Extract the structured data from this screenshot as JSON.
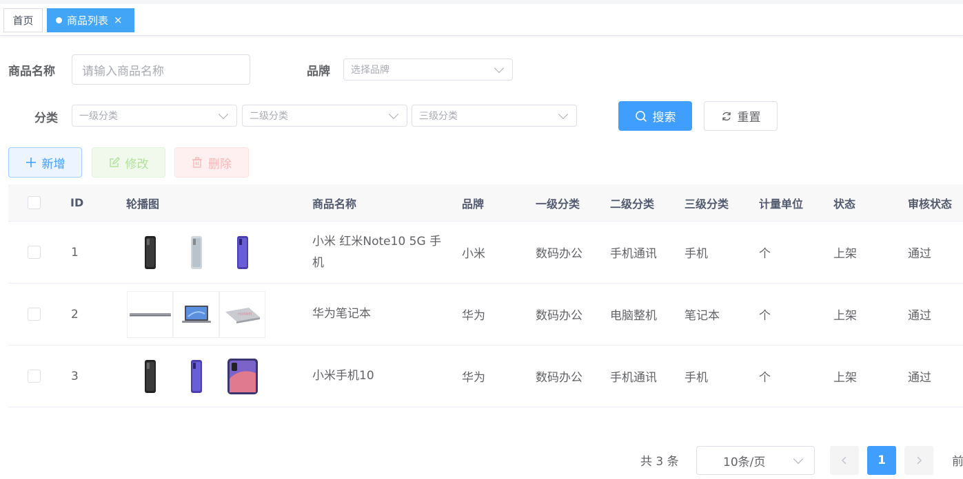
{
  "tabs": [
    {
      "label": "首页",
      "active": false
    },
    {
      "label": "商品列表",
      "active": true
    }
  ],
  "form": {
    "name_label": "商品名称",
    "name_placeholder": "请输入商品名称",
    "brand_label": "品牌",
    "brand_placeholder": "选择品牌",
    "category_label": "分类",
    "cat1_placeholder": "一级分类",
    "cat2_placeholder": "二级分类",
    "cat3_placeholder": "三级分类",
    "search_label": "搜索",
    "reset_label": "重置"
  },
  "toolbar": {
    "add_label": "新增",
    "edit_label": "修改",
    "delete_label": "删除"
  },
  "table": {
    "headers": [
      "ID",
      "轮播图",
      "商品名称",
      "品牌",
      "一级分类",
      "二级分类",
      "三级分类",
      "计量单位",
      "状态",
      "审核状态"
    ],
    "rows": [
      {
        "id": "1",
        "name": "小米 红米Note10 5G 手机",
        "brand": "小米",
        "cat1": "数码办公",
        "cat2": "手机通讯",
        "cat3": "手机",
        "unit": "个",
        "status": "上架",
        "audit": "通过",
        "images": [
          "phone-black",
          "phone-silver",
          "phone-purple"
        ]
      },
      {
        "id": "2",
        "name": "华为笔记本",
        "brand": "华为",
        "cat1": "数码办公",
        "cat2": "电脑整机",
        "cat3": "笔记本",
        "unit": "个",
        "status": "上架",
        "audit": "通过",
        "images": [
          "laptop-side",
          "laptop-front",
          "laptop-angle"
        ]
      },
      {
        "id": "3",
        "name": "小米手机10",
        "brand": "华为",
        "cat1": "数码办公",
        "cat2": "手机通讯",
        "cat3": "手机",
        "unit": "个",
        "status": "上架",
        "audit": "通过",
        "images": [
          "phone-black",
          "phone-purple",
          "phone-wallpaper"
        ]
      }
    ]
  },
  "pagination": {
    "total_text": "共 3 条",
    "page_size": "10条/页",
    "current_page": "1",
    "goto_text": "前"
  },
  "colors": {
    "primary": "#409eff",
    "tab_active": "#42a5f5"
  }
}
